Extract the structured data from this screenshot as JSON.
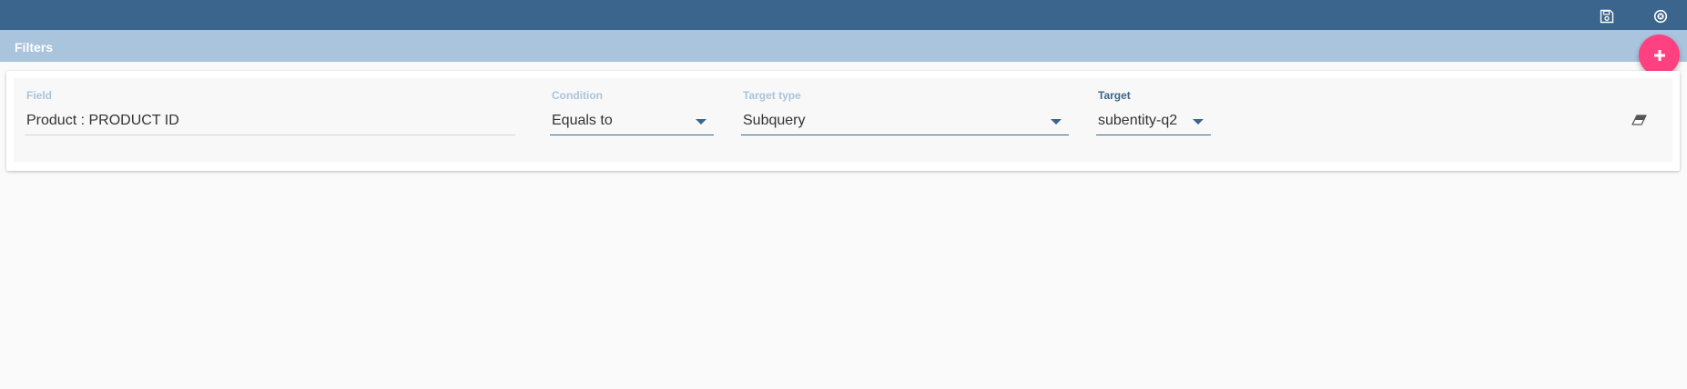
{
  "toolbar": {
    "icons": [
      "floppy-disk-icon",
      "close-circle-icon"
    ],
    "colors": {
      "bar": "#3b658c",
      "subbar": "#a9c4dc",
      "accent": "#ff4081"
    }
  },
  "filters": {
    "title": "Filters",
    "add_icon": "plus-icon",
    "row": {
      "field": {
        "label": "Field",
        "value": "Product : PRODUCT ID"
      },
      "condition": {
        "label": "Condition",
        "value": "Equals to"
      },
      "target_type": {
        "label": "Target type",
        "value": "Subquery"
      },
      "target": {
        "label": "Target",
        "value": "subentity-q2"
      },
      "clear_icon": "eraser-icon"
    }
  }
}
